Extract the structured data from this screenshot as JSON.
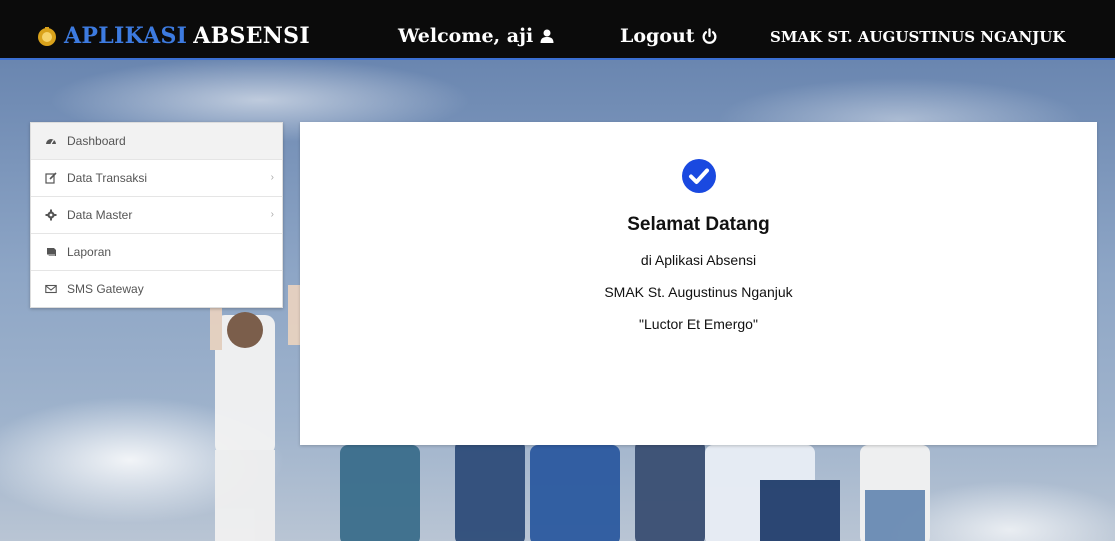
{
  "header": {
    "brand_part1": "APLIKASI",
    "brand_part2": "ABSENSI",
    "welcome": "Welcome, aji",
    "logout": "Logout",
    "school": "SMAK ST. AUGUSTINUS NGANJUK"
  },
  "sidebar": {
    "items": [
      {
        "label": "Dashboard",
        "icon": "dashboard-icon"
      },
      {
        "label": "Data Transaksi",
        "icon": "edit-icon"
      },
      {
        "label": "Data Master",
        "icon": "gear-icon"
      },
      {
        "label": "Laporan",
        "icon": "book-icon"
      },
      {
        "label": "SMS Gateway",
        "icon": "envelope-icon"
      }
    ]
  },
  "main": {
    "title": "Selamat Datang",
    "line1": "di Aplikasi Absensi",
    "line2": "SMAK St. Augustinus Nganjuk",
    "line3": "\"Luctor Et Emergo\""
  },
  "colors": {
    "navbar": "#0b0b0b",
    "accent": "#3d7be0",
    "check": "#1a49e0"
  }
}
